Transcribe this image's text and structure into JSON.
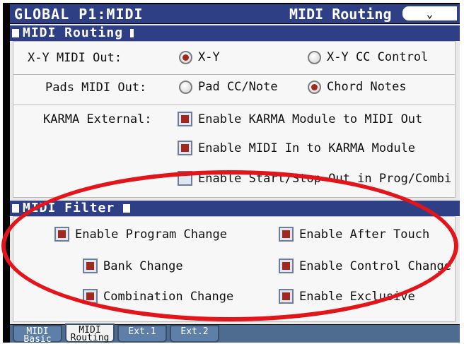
{
  "header": {
    "title": "GLOBAL P1:MIDI",
    "page_name": "MIDI Routing",
    "menu_icon": "chevron-down-icon"
  },
  "routing": {
    "title": "MIDI Routing",
    "xy_label": "X-Y MIDI Out:",
    "xy_options": [
      "X-Y",
      "X-Y CC Control"
    ],
    "xy_selected": "X-Y",
    "pads_label": "Pads MIDI Out:",
    "pads_options": [
      "Pad CC/Note",
      "Chord Notes"
    ],
    "pads_selected": "Chord Notes",
    "karma_label": "KARMA External:",
    "karma_options": [
      {
        "label": "Enable KARMA Module to MIDI Out",
        "checked": true
      },
      {
        "label": "Enable MIDI In to KARMA Module",
        "checked": true
      },
      {
        "label": "Enable Start/Stop Out in Prog/Combi",
        "checked": false
      }
    ]
  },
  "filter": {
    "title": "MIDI Filter",
    "left": [
      {
        "label": "Enable Program Change",
        "checked": true
      },
      {
        "label": "Bank Change",
        "checked": true
      },
      {
        "label": "Combination Change",
        "checked": true
      }
    ],
    "right": [
      {
        "label": "Enable After Touch",
        "checked": true
      },
      {
        "label": "Enable Control Change",
        "checked": true
      },
      {
        "label": "Enable Exclusive",
        "checked": true
      }
    ]
  },
  "tabs": [
    {
      "line1": "MIDI",
      "line2": "Basic",
      "active": false
    },
    {
      "line1": "MIDI",
      "line2": "Routing",
      "active": true
    },
    {
      "line1": "Ext.1",
      "line2": "",
      "active": false
    },
    {
      "line1": "Ext.2",
      "line2": "",
      "active": false
    }
  ],
  "colors": {
    "accent": "#2f3f86",
    "selected": "#a1281f",
    "annotation": "#e4141b"
  }
}
